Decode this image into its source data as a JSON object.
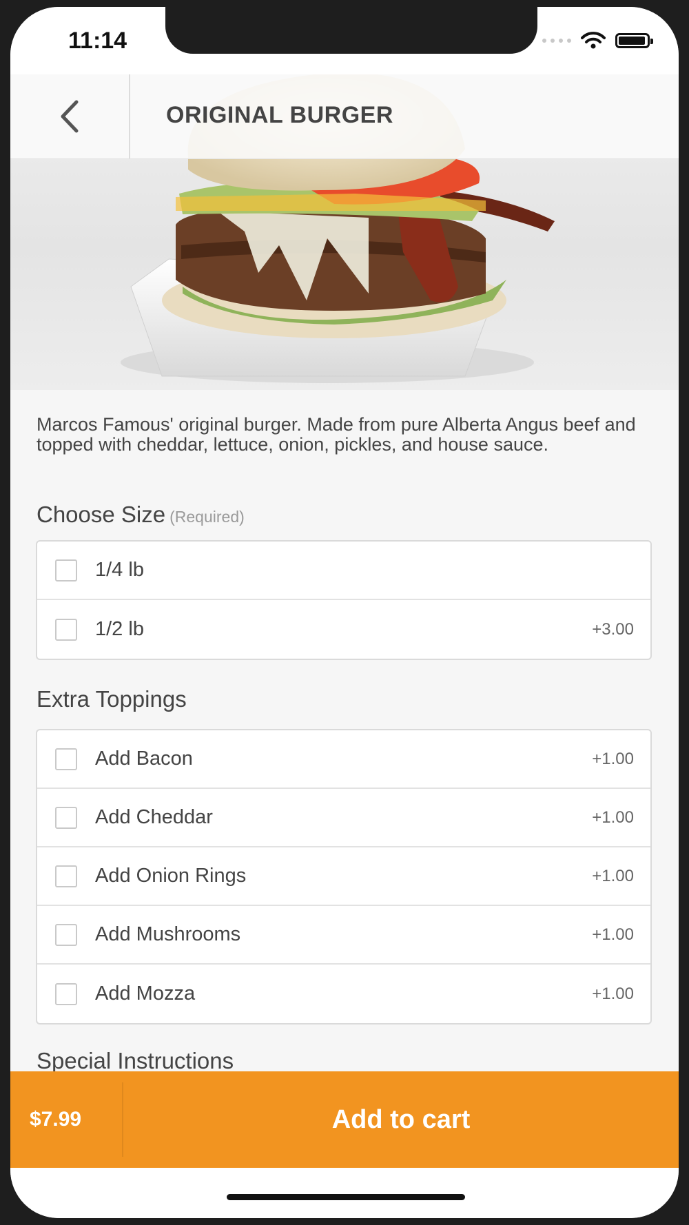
{
  "status": {
    "time": "11:14"
  },
  "header": {
    "title": "ORIGINAL BURGER"
  },
  "product": {
    "description": "Marcos Famous' original burger. Made from pure Alberta Angus beef and topped with cheddar, lettuce, onion, pickles, and house sauce."
  },
  "size": {
    "title": "Choose Size",
    "required": "(Required)",
    "options": [
      {
        "label": "1/4 lb",
        "price": "",
        "checked": false
      },
      {
        "label": "1/2 lb",
        "price": "+3.00",
        "checked": false
      }
    ]
  },
  "toppings": {
    "title": "Extra Toppings",
    "options": [
      {
        "label": "Add Bacon",
        "price": "+1.00",
        "checked": false
      },
      {
        "label": "Add Cheddar",
        "price": "+1.00",
        "checked": false
      },
      {
        "label": "Add Onion Rings",
        "price": "+1.00",
        "checked": false
      },
      {
        "label": "Add Mushrooms",
        "price": "+1.00",
        "checked": false
      },
      {
        "label": "Add Mozza",
        "price": "+1.00",
        "checked": false
      }
    ]
  },
  "instructions": {
    "title": "Special Instructions"
  },
  "cart": {
    "price": "$7.99",
    "button_label": "Add to cart"
  },
  "colors": {
    "accent": "#f29420",
    "background": "#f6f6f6"
  },
  "icons": {
    "back": "chevron-left-icon",
    "wifi": "wifi-icon",
    "battery": "battery-icon"
  }
}
